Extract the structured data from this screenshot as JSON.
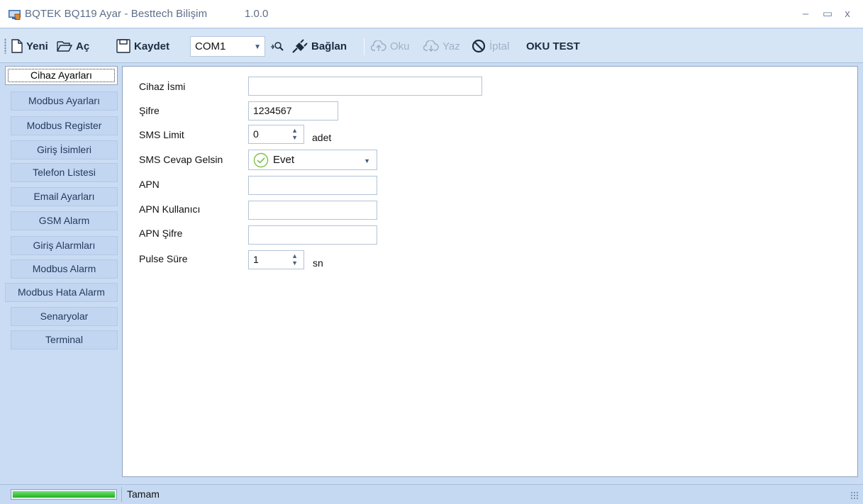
{
  "window": {
    "title": "BQTEK BQ119 Ayar - Besttech Bilişim",
    "version": "1.0.0",
    "controls": {
      "minimize": "–",
      "maximize": "▭",
      "close": "x"
    }
  },
  "toolbar": {
    "new_label": "Yeni",
    "open_label": "Aç",
    "save_label": "Kaydet",
    "port_value": "COM1",
    "connect_label": "Bağlan",
    "read_label": "Oku",
    "write_label": "Yaz",
    "cancel_label": "İptal",
    "test_label": "OKU TEST"
  },
  "tabs": [
    {
      "label": "Cihaz Ayarları",
      "active": true
    },
    {
      "label": "Modbus Ayarları"
    },
    {
      "label": "Modbus Register"
    },
    {
      "label": "Giriş İsimleri"
    },
    {
      "label": "Telefon Listesi"
    },
    {
      "label": "Email Ayarları"
    },
    {
      "label": "GSM Alarm"
    },
    {
      "label": "Giriş Alarmları"
    },
    {
      "label": "Modbus Alarm"
    },
    {
      "label": "Modbus Hata Alarm"
    },
    {
      "label": "Senaryolar"
    },
    {
      "label": "Terminal"
    }
  ],
  "form": {
    "device_name": {
      "label": "Cihaz İsmi",
      "value": ""
    },
    "password": {
      "label": "Şifre",
      "value": "1234567"
    },
    "sms_limit": {
      "label": "SMS Limit",
      "value": "0",
      "unit": "adet"
    },
    "sms_reply": {
      "label": "SMS Cevap Gelsin",
      "value": "Evet"
    },
    "apn": {
      "label": "APN",
      "value": ""
    },
    "apn_user": {
      "label": "APN Kullanıcı",
      "value": ""
    },
    "apn_password": {
      "label": "APN Şifre",
      "value": ""
    },
    "pulse": {
      "label": "Pulse Süre",
      "value": "1",
      "unit": "sn"
    }
  },
  "statusbar": {
    "progress_percent": 100,
    "text": "Tamam"
  },
  "colors": {
    "window_bg": "#c9dcf3",
    "tab_bg": "#c2d6f1",
    "progress_green": "#1fb31f"
  }
}
